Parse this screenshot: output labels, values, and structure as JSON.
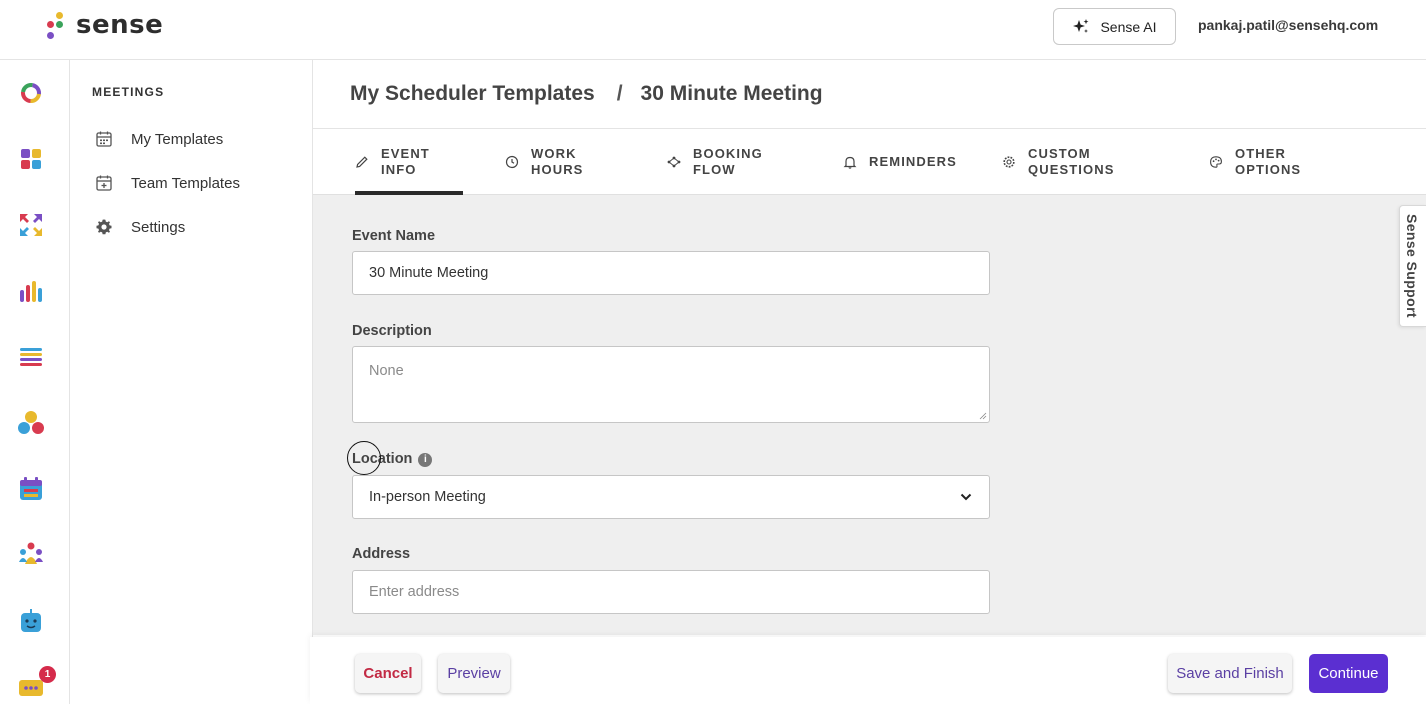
{
  "brand": {
    "name": "sense",
    "dot_colors": [
      "#e8b92d",
      "#d83b4f",
      "#3aa35b",
      "#7a4fc4"
    ]
  },
  "topbar": {
    "ai_button_label": "Sense AI",
    "user_email": "pankaj.patil@sensehq.com"
  },
  "rail": {
    "icons": [
      "dashboard-ring-icon",
      "apps-grid-icon",
      "arrows-icon",
      "analytics-icon",
      "lists-icon",
      "people-bubbles-icon",
      "calendar-icon",
      "community-icon",
      "bot-icon",
      "chat-icon"
    ],
    "chat_badge": "1"
  },
  "sidebar": {
    "heading": "MEETINGS",
    "items": [
      {
        "label": "My Templates",
        "icon": "calendar-icon"
      },
      {
        "label": "Team Templates",
        "icon": "calendar-plus-icon"
      },
      {
        "label": "Settings",
        "icon": "gear-icon"
      }
    ]
  },
  "breadcrumb": {
    "parent": "My Scheduler Templates",
    "separator": "/",
    "current": "30 Minute Meeting"
  },
  "tabs": [
    {
      "line1": "EVENT",
      "line2": "INFO",
      "icon": "pencil-icon",
      "active": true
    },
    {
      "line1": "WORK",
      "line2": "HOURS",
      "icon": "clock-icon",
      "active": false
    },
    {
      "line1": "BOOKING",
      "line2": "FLOW",
      "icon": "flow-icon",
      "active": false
    },
    {
      "line1": "REMINDERS",
      "line2": "",
      "icon": "bell-icon",
      "active": false
    },
    {
      "line1": "CUSTOM",
      "line2": "QUESTIONS",
      "icon": "gear-icon",
      "active": false
    },
    {
      "line1": "OTHER",
      "line2": "OPTIONS",
      "icon": "palette-icon",
      "active": false
    }
  ],
  "form": {
    "event_name": {
      "label": "Event Name",
      "value": "30 Minute Meeting"
    },
    "description": {
      "label": "Description",
      "placeholder": "None"
    },
    "location": {
      "label": "Location",
      "info": "i",
      "value": "In-person Meeting"
    },
    "address": {
      "label": "Address",
      "placeholder": "Enter address"
    }
  },
  "footer": {
    "cancel": "Cancel",
    "preview": "Preview",
    "save_finish": "Save and Finish",
    "continue": "Continue"
  },
  "support_tab": "Sense Support",
  "colors": {
    "accent": "#5b2fd1",
    "cancel": "#c22a44",
    "badge": "#d52b4b"
  }
}
